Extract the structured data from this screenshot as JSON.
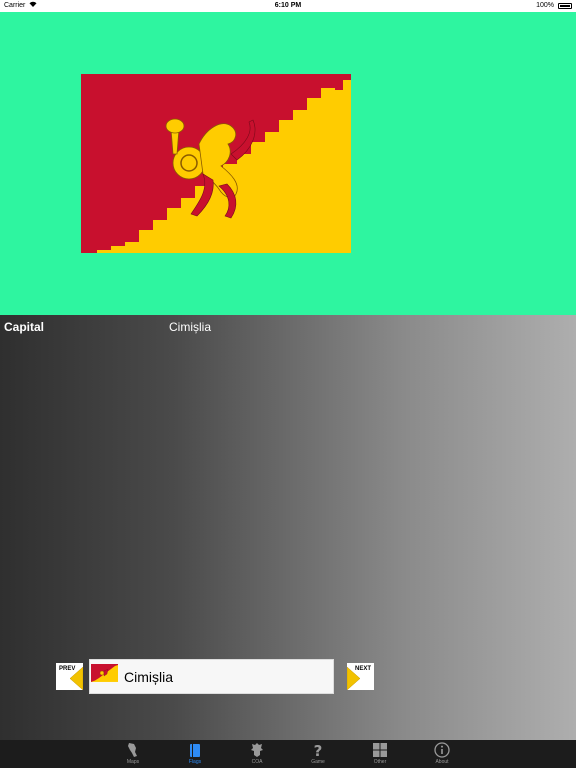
{
  "status_bar": {
    "carrier": "Carrier",
    "time": "6:10 PM",
    "battery": "100%"
  },
  "flag": {
    "description_icon": "cimislia-flag",
    "colors": {
      "red": "#c8102e",
      "yellow": "#ffcc00",
      "background": "#2ef5a0"
    }
  },
  "details": {
    "capital_label": "Capital",
    "capital_value": "Cimișlia"
  },
  "navigator": {
    "prev_label": "PREV",
    "next_label": "NEXT",
    "current_name": "Cimișlia"
  },
  "tabs": [
    {
      "label": "Maps",
      "icon": "map-icon",
      "active": false
    },
    {
      "label": "Flags",
      "icon": "flag-book-icon",
      "active": true
    },
    {
      "label": "COA",
      "icon": "coat-of-arms-icon",
      "active": false
    },
    {
      "label": "Game",
      "icon": "question-icon",
      "active": false
    },
    {
      "label": "Other",
      "icon": "grid-icon",
      "active": false
    },
    {
      "label": "About",
      "icon": "info-icon",
      "active": false
    }
  ]
}
